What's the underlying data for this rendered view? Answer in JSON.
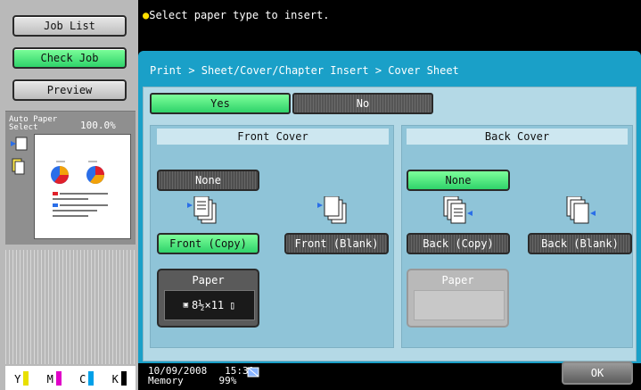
{
  "left_panel": {
    "job_list_label": "Job List",
    "check_job_label": "Check Job",
    "preview_label": "Preview",
    "auto_paper_line1": "Auto Paper",
    "auto_paper_line2": "Select",
    "zoom": "100.0%",
    "toner": [
      {
        "label": "Y",
        "color": "#e8e000"
      },
      {
        "label": "M",
        "color": "#e000c8"
      },
      {
        "label": "C",
        "color": "#00a0e8"
      },
      {
        "label": "K",
        "color": "#000000"
      }
    ]
  },
  "message": "Select paper type to insert.",
  "breadcrumb": "Print > Sheet/Cover/Chapter Insert > Cover Sheet",
  "yes_label": "Yes",
  "no_label": "No",
  "front": {
    "title": "Front Cover",
    "none_label": "None",
    "copy_label": "Front (Copy)",
    "blank_label": "Front (Blank)",
    "paper_label": "Paper",
    "paper_size": "8½×11"
  },
  "back": {
    "title": "Back Cover",
    "none_label": "None",
    "copy_label": "Back  (Copy)",
    "blank_label": "Back (Blank)",
    "paper_label": "Paper"
  },
  "status": {
    "date": "10/09/2008",
    "time": "15:31",
    "memory_label": "Memory",
    "memory_value": "99%"
  },
  "ok_label": "OK",
  "colors": {
    "accent_green": "#2fd26a",
    "dialog_blue": "#1aa0c8"
  }
}
